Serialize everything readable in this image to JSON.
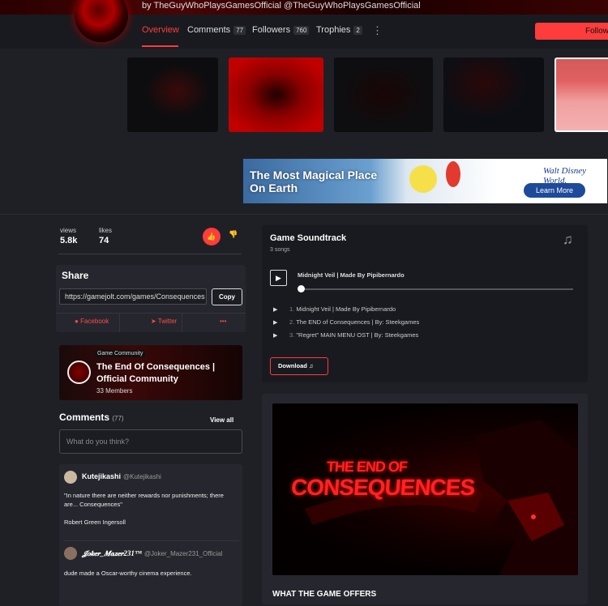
{
  "header": {
    "byline": "by TheGuyWhoPlaysGamesOfficial @TheGuyWhoPlaysGamesOfficial",
    "tabs": [
      {
        "label": "Overview"
      },
      {
        "label": "Comments",
        "count": "77"
      },
      {
        "label": "Followers",
        "count": "760"
      },
      {
        "label": "Trophies",
        "count": "2"
      }
    ],
    "more_icon": "kebab-icon",
    "follow_label": "Follow"
  },
  "ad": {
    "headline": "The Most Magical Place On Earth",
    "brand": "Walt Disney World.",
    "cta": "Learn More"
  },
  "stats": {
    "views_label": "views",
    "views": "5.8k",
    "likes_label": "likes",
    "likes": "74"
  },
  "share": {
    "title": "Share",
    "url": "https://gamejolt.com/games/Consequences",
    "copy_label": "Copy",
    "facebook": "Facebook",
    "twitter": "Twitter",
    "more": "•••"
  },
  "community": {
    "badge": "Game Community",
    "title": "The End Of Consequences | Official Community",
    "members": "33 Members"
  },
  "comments": {
    "title": "Comments",
    "count": "(77)",
    "view_all": "View all",
    "placeholder": "What do you think?",
    "items": [
      {
        "user": "Kutejikashi",
        "handle": "@Kutejikashi",
        "text1": "\"In nature there are neither rewards nor punishments; there are... Consequences\"",
        "text2": "Robert Green Ingersoll"
      },
      {
        "user": "𝓙𝒐𝒌𝒆𝒓_𝑴𝒂𝒛𝒆𝒓231™",
        "handle": "@Joker_Mazer231_Official",
        "text1": "dude made a Oscar-worthy cinema experience."
      }
    ]
  },
  "soundtrack": {
    "title": "Game Soundtrack",
    "subtitle": "3 songs",
    "now_playing": "Midnight Veil | Made By Pipibernardo",
    "tracks": [
      {
        "num": "1.",
        "name": "Midnight Veil | Made By Pipibernardo"
      },
      {
        "num": "2.",
        "name": "The END of Consequences | By: Steekgames"
      },
      {
        "num": "3.",
        "name": "\"Regret\" MAIN MENU OST | By: Steekgames"
      }
    ],
    "download_label": "Download"
  },
  "trailer": {
    "line1": "THE END OF",
    "line2": "CONSEQUENCES"
  },
  "section_heading": "WHAT THE GAME OFFERS",
  "colors": {
    "accent": "#ff3c3c",
    "background": "#1f2026",
    "panel": "#26272e"
  }
}
